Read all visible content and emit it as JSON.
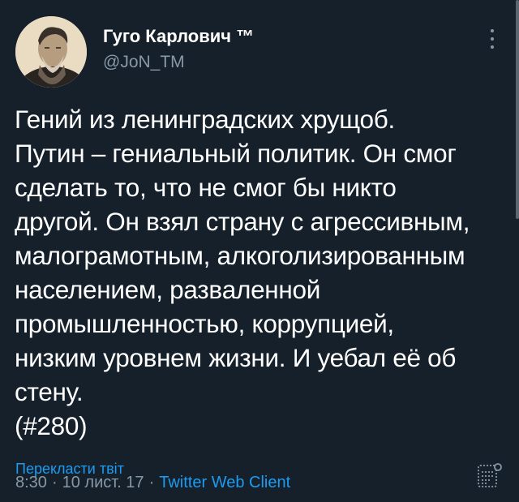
{
  "tweet": {
    "display_name": "Гуго Карлович ™",
    "handle": "@JoN_TM",
    "text": "Гений из ленинградских хрущоб.\nПутин – гениальный политик. Он смог\nсделать то, что не смог бы никто\nдругой. Он взял страну с агрессивным,\nмалограмотным, алкоголизированным\nнаселением, развaленной\nпромышленностью, коррупцией,\nнизким уровнем жизни. И уебал её об\nстену.\n(#280)",
    "translate_label": "Перекласти твіт",
    "time": "8:30",
    "date": "10 лист. 17",
    "separator": "·",
    "client": "Twitter Web Client"
  },
  "icons": {
    "more": "more-vertical-icon",
    "analytics": "analytics-icon"
  },
  "colors": {
    "background": "#15202b",
    "text": "#ffffff",
    "secondary": "#8899a6",
    "link": "#1d9bf0"
  }
}
